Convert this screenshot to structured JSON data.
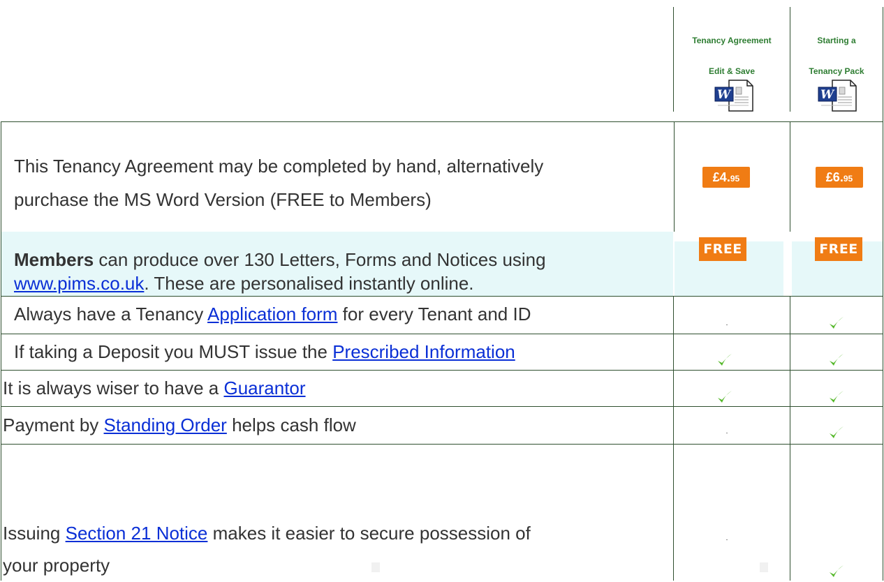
{
  "header": {
    "col1": {
      "line1": "Tenancy Agreement",
      "line2": "Edit & Save",
      "icon": "word-document-icon"
    },
    "col2": {
      "line1": "Starting a",
      "line2": "Tenancy Pack",
      "icon": "word-document-icon"
    }
  },
  "rows": [
    {
      "lines": [
        [
          "This Tenancy Agreement  may be completed by hand, alternatively"
        ],
        [
          "purchase the MS Word Version (FREE to Members)"
        ]
      ],
      "col1": "price",
      "col2": "price"
    },
    {
      "lines": [
        [
          "Members",
          " can produce over 130 Letters, Forms and Notices using"
        ],
        [
          "www.pims.co.uk",
          ". These are personalised instantly online."
        ]
      ]
    },
    {
      "pre": "Always have a Tenancy ",
      "link": "Application form",
      "post": " for every Tenant and ID",
      "col1": "none",
      "col2": "check"
    },
    {
      "pre": "If taking a Deposit you MUST issue the ",
      "link": "Prescribed Information",
      "post": "",
      "col1": "check",
      "col2": "check"
    },
    {
      "pre": "It is always wiser to have a ",
      "link": "Guarantor",
      "post": "",
      "col1": "check",
      "col2": "check"
    },
    {
      "pre": "Payment by ",
      "link": "Standing Order",
      "post": " helps cash flow",
      "col1": "none",
      "col2": "check"
    },
    {
      "pre": "Issuing  ",
      "link": "Section 21 Notice",
      "post": " makes it easier to secure possession of",
      "line2": "your property",
      "col1": "none",
      "col2": "check"
    }
  ],
  "prices": {
    "col1": {
      "main": "£4.",
      "decimal": "95"
    },
    "col2": {
      "main": "£6.",
      "decimal": "95"
    }
  },
  "free_badge": "FREE",
  "colors": {
    "link": "#0a2fd6",
    "header_green": "#2e7d32",
    "badge_orange": "#f07c14",
    "highlight_band": "#e6f8f9",
    "check_green": "#55b82a"
  }
}
